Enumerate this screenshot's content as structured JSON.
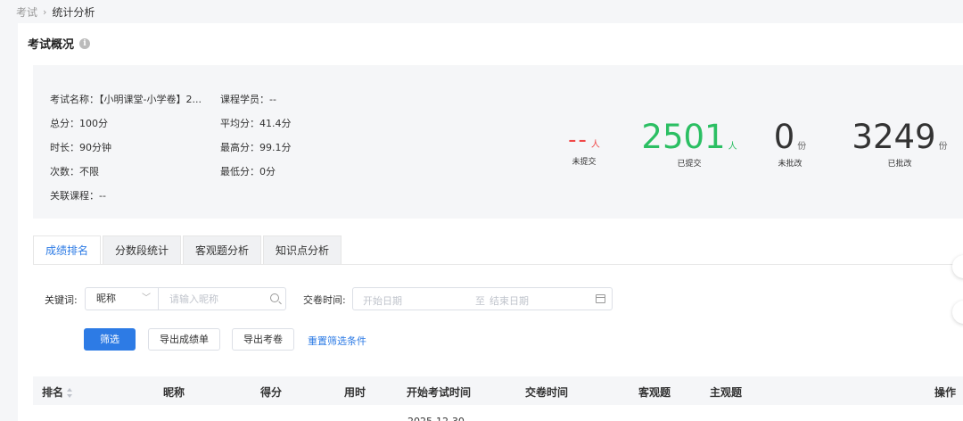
{
  "breadcrumb": {
    "parent": "考试",
    "separator": "›",
    "current": "统计分析"
  },
  "page_title": "考试概况",
  "overview": {
    "info": [
      {
        "label": "考试名称：",
        "value": "【小明课堂-小学卷】2..."
      },
      {
        "label": "课程学员：",
        "value": "--"
      },
      {
        "label": "总分：",
        "value": "100分"
      },
      {
        "label": "平均分：",
        "value": "41.4分"
      },
      {
        "label": "时长：",
        "value": "90分钟"
      },
      {
        "label": "最高分：",
        "value": "99.1分"
      },
      {
        "label": "次数：",
        "value": "不限"
      },
      {
        "label": "最低分：",
        "value": "0分"
      },
      {
        "label": "关联课程：",
        "value": "--"
      }
    ],
    "stats": [
      {
        "value": "--",
        "unit": "人",
        "caption": "未提交",
        "color": "#f04848"
      },
      {
        "value": "2501",
        "unit": "人",
        "caption": "已提交",
        "color": "#2bbf63"
      },
      {
        "value": "0",
        "unit": "份",
        "caption": "未批改",
        "color": "#333333"
      },
      {
        "value": "3249",
        "unit": "份",
        "caption": "已批改",
        "color": "#333333"
      }
    ]
  },
  "tabs": [
    {
      "label": "成绩排名",
      "active": true
    },
    {
      "label": "分数段统计",
      "active": false
    },
    {
      "label": "客观题分析",
      "active": false
    },
    {
      "label": "知识点分析",
      "active": false
    }
  ],
  "filters": {
    "keyword_label": "关键词:",
    "keyword_type": "昵称",
    "keyword_placeholder": "请输入昵称",
    "submit_time_label": "交卷时间:",
    "date_start_placeholder": "开始日期",
    "date_separator": "至",
    "date_end_placeholder": "结束日期"
  },
  "actions": {
    "filter": "筛选",
    "export_scores": "导出成绩单",
    "export_papers": "导出考卷",
    "reset": "重置筛选条件"
  },
  "table": {
    "columns": [
      "排名",
      "昵称",
      "得分",
      "用时",
      "开始考试时间",
      "交卷时间",
      "客观题",
      "主观题",
      "操作"
    ],
    "first_row_partial": "2025-12-30"
  },
  "colors": {
    "primary": "#2d7be5",
    "not_submitted": "#f04848",
    "submitted": "#2bbf63"
  }
}
